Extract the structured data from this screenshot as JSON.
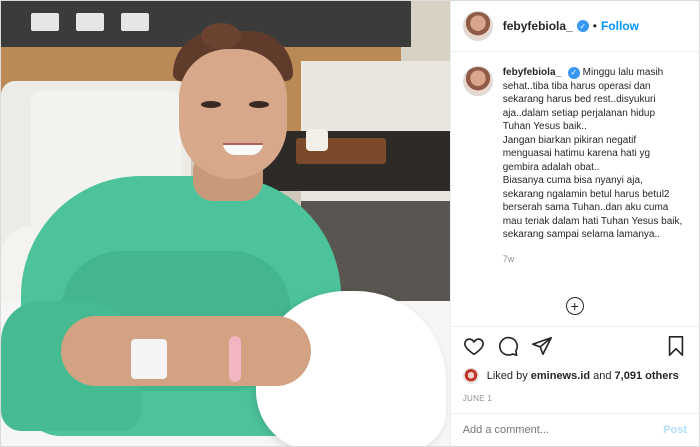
{
  "header": {
    "username": "febyfebiola_",
    "verified_glyph": "✓",
    "separator": "•",
    "follow_label": "Follow"
  },
  "caption": {
    "username": "febyfebiola_",
    "text": "Minggu lalu masih sehat..tiba tiba harus operasi dan sekarang harus bed rest..disyukuri aja..dalam setiap perjalanan hidup Tuhan Yesus baik..\nJangan biarkan pikiran negatif menguasai hatimu karena hati yg gembira adalah obat..\nBiasanya cuma bisa nyanyi aja, sekarang ngalamin betul harus betul2 berserah sama Tuhan..dan aku cuma mau teriak dalam hati Tuhan Yesus baik, sekarang sampai selama lamanya..",
    "time": "7w",
    "more_glyph": "+"
  },
  "actions": {
    "icons": [
      "heart-icon",
      "comment-icon",
      "share-icon",
      "bookmark-icon"
    ]
  },
  "likes": {
    "prefix": "Liked by",
    "liker": "eminews.id",
    "connector": "and",
    "others": "7,091 others"
  },
  "date": "JUNE 1",
  "comment": {
    "placeholder": "Add a comment...",
    "post_label": "Post"
  },
  "colors": {
    "accent": "#0095f6",
    "verified": "#3897f0",
    "post_disabled": "#b2dffc"
  }
}
